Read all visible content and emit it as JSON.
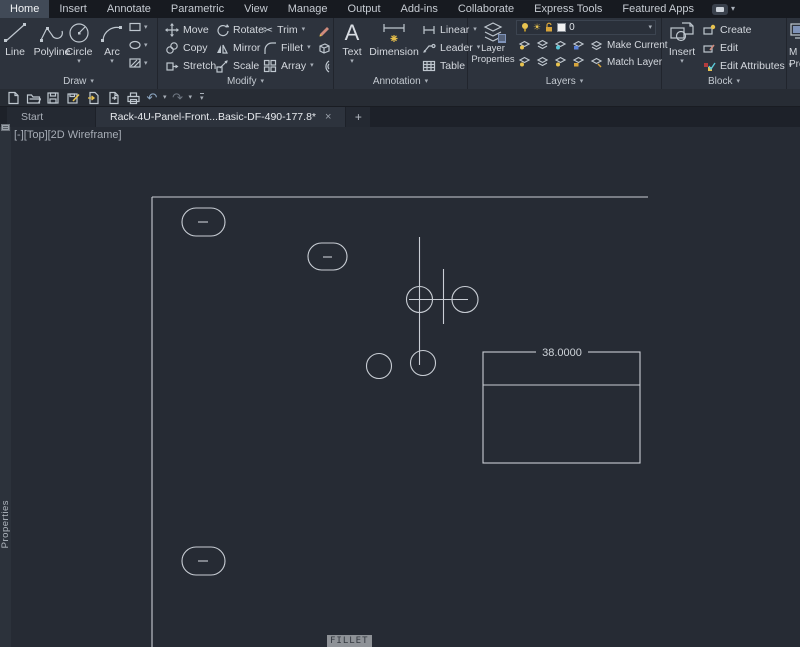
{
  "tabs": {
    "items": [
      {
        "label": "Home",
        "active": true
      },
      {
        "label": "Insert"
      },
      {
        "label": "Annotate"
      },
      {
        "label": "Parametric"
      },
      {
        "label": "View"
      },
      {
        "label": "Manage"
      },
      {
        "label": "Output"
      },
      {
        "label": "Add-ins"
      },
      {
        "label": "Collaborate"
      },
      {
        "label": "Express Tools"
      },
      {
        "label": "Featured Apps"
      }
    ]
  },
  "draw": {
    "label": "Draw",
    "line": "Line",
    "polyline": "Polyline",
    "circle": "Circle",
    "arc": "Arc"
  },
  "modify": {
    "label": "Modify",
    "move": "Move",
    "copy": "Copy",
    "stretch": "Stretch",
    "rotate": "Rotate",
    "mirror": "Mirror",
    "scale": "Scale",
    "trim": "Trim",
    "fillet": "Fillet",
    "array": "Array"
  },
  "annotation": {
    "label": "Annotation",
    "text": "Text",
    "dimension": "Dimension",
    "linear": "Linear",
    "leader": "Leader",
    "table": "Table"
  },
  "layers": {
    "label": "Layers",
    "layer_properties_1": "Layer",
    "layer_properties_2": "Properties",
    "current_layer": "0",
    "make_current": "Make Current",
    "match_layer": "Match Layer"
  },
  "block": {
    "label": "Block",
    "insert": "Insert",
    "create": "Create",
    "edit": "Edit",
    "edit_attributes": "Edit Attributes"
  },
  "properties_panel_cut": {
    "line1": "M",
    "line2": "Prop"
  },
  "file_tabs": {
    "start": "Start",
    "document": "Rack-4U-Panel-Front...Basic-DF-490-177.8*",
    "close": "×",
    "new_tab": "+"
  },
  "viewport": {
    "controls": "[-][Top][2D Wireframe]"
  },
  "palette": {
    "title": "Properties"
  },
  "drawing": {
    "dimension": "38.0000",
    "command_echo": "FILLET"
  },
  "colors": {
    "canvas": "#262b34",
    "ribbon": "#2d333d",
    "wireframe": "#c9ced5",
    "accent_yellow": "#e4bd4a",
    "active_tab": "#414a57"
  }
}
